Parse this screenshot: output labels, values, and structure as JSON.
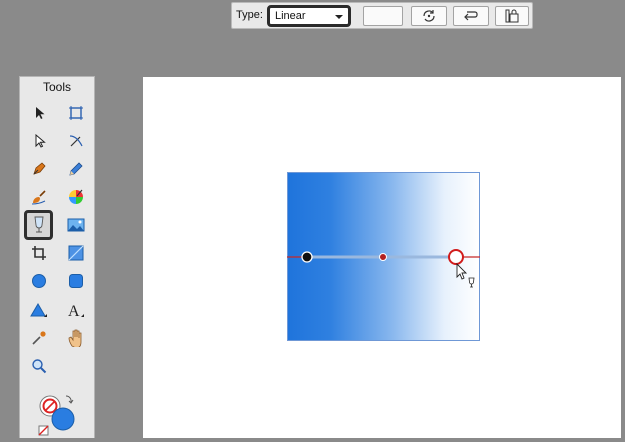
{
  "toolbar": {
    "type_label": "Type:",
    "type_value": "Linear",
    "icons": [
      "swatch-preview",
      "rotate-icon",
      "reverse-icon",
      "lock-icon"
    ]
  },
  "tools_panel": {
    "title": "Tools",
    "tools": [
      "selection-arrow-icon",
      "artboard-icon",
      "subselect-arrow-icon",
      "freeform-icon",
      "pen-icon",
      "pencil-icon",
      "brush-icon",
      "color-wheel-icon",
      "gradient-tool-icon",
      "image-icon",
      "crop-icon",
      "slice-icon",
      "circle-icon",
      "rounded-rect-icon",
      "triangle-icon",
      "text-icon",
      "eyedropper-icon",
      "hand-icon",
      "zoom-icon"
    ],
    "active_tool": "gradient-tool-icon",
    "fill_color": "#2a7de1"
  },
  "canvas": {
    "gradient_start_color": "#1f74dc",
    "gradient_end_color": "#ffffff",
    "handle_color": "#d11b1b"
  }
}
